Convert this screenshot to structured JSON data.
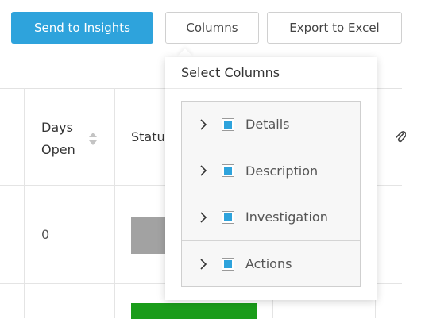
{
  "toolbar": {
    "send_label": "Send to Insights",
    "columns_label": "Columns",
    "export_label": "Export to Excel"
  },
  "table": {
    "headers": {
      "days_open_line1": "Days",
      "days_open_line2": "Open",
      "status": "Statu"
    },
    "rows": [
      {
        "days_open": "0",
        "status_color": "#a2a2a2"
      },
      {
        "days_open": "",
        "status_color": "#1a9c1a"
      }
    ]
  },
  "columns_dropdown": {
    "title": "Select Columns",
    "items": [
      {
        "label": "Details",
        "checked": true
      },
      {
        "label": "Description",
        "checked": true
      },
      {
        "label": "Investigation",
        "checked": true
      },
      {
        "label": "Actions",
        "checked": true
      }
    ]
  },
  "colors": {
    "primary": "#2ea3dc",
    "checkbox_fill": "#2ea3dc"
  },
  "icons": {
    "sort": "sort-icon",
    "attachment": "paperclip-icon",
    "expand": "chevron-right-icon"
  }
}
